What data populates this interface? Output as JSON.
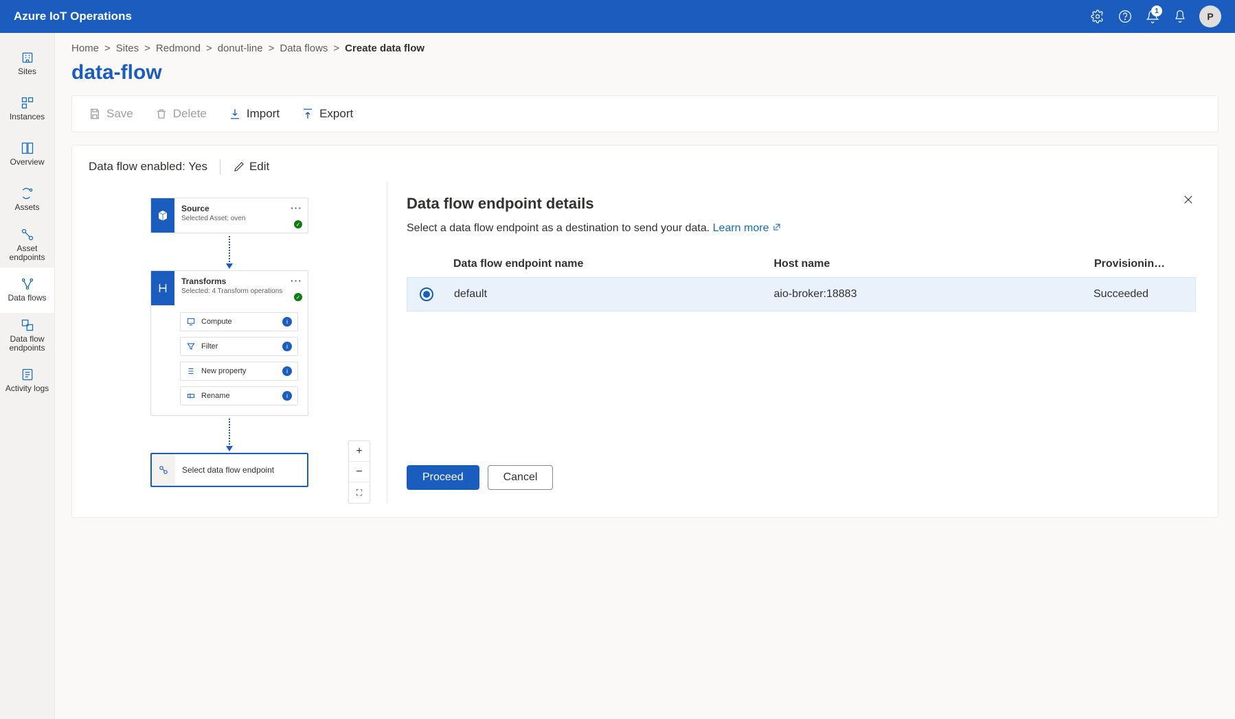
{
  "header": {
    "brand": "Azure IoT Operations",
    "notifications_badge": "1",
    "avatar_initial": "P"
  },
  "sidebar": {
    "items": [
      {
        "key": "sites",
        "label": "Sites"
      },
      {
        "key": "instances",
        "label": "Instances"
      },
      {
        "key": "overview",
        "label": "Overview"
      },
      {
        "key": "assets",
        "label": "Assets"
      },
      {
        "key": "asset-endpoints",
        "label": "Asset endpoints"
      },
      {
        "key": "data-flows",
        "label": "Data flows",
        "active": true
      },
      {
        "key": "data-flow-endpoints",
        "label": "Data flow endpoints"
      },
      {
        "key": "activity-logs",
        "label": "Activity logs"
      }
    ]
  },
  "breadcrumbs": {
    "items": [
      {
        "label": "Home"
      },
      {
        "label": "Sites"
      },
      {
        "label": "Redmond"
      },
      {
        "label": "donut-line"
      },
      {
        "label": "Data flows"
      },
      {
        "label": "Create data flow",
        "current": true
      }
    ]
  },
  "page": {
    "title": "data-flow"
  },
  "toolbar": {
    "save": "Save",
    "delete": "Delete",
    "import": "Import",
    "export": "Export"
  },
  "flow": {
    "enabled_label": "Data flow enabled: Yes",
    "edit_label": "Edit",
    "source": {
      "title": "Source",
      "subtitle": "Selected Asset: oven"
    },
    "transforms": {
      "title": "Transforms",
      "subtitle": "Selected: 4 Transform operations",
      "ops": [
        {
          "label": "Compute"
        },
        {
          "label": "Filter"
        },
        {
          "label": "New property"
        },
        {
          "label": "Rename"
        }
      ]
    },
    "destination": {
      "label": "Select data flow endpoint"
    }
  },
  "panel": {
    "title": "Data flow endpoint details",
    "description": "Select a data flow endpoint as a destination to send your data.",
    "learn_more": "Learn more",
    "columns": {
      "name": "Data flow endpoint name",
      "host": "Host name",
      "state": "Provisionin…"
    },
    "rows": [
      {
        "name": "default",
        "host": "aio-broker:18883",
        "state": "Succeeded",
        "selected": true
      }
    ],
    "proceed": "Proceed",
    "cancel": "Cancel"
  }
}
